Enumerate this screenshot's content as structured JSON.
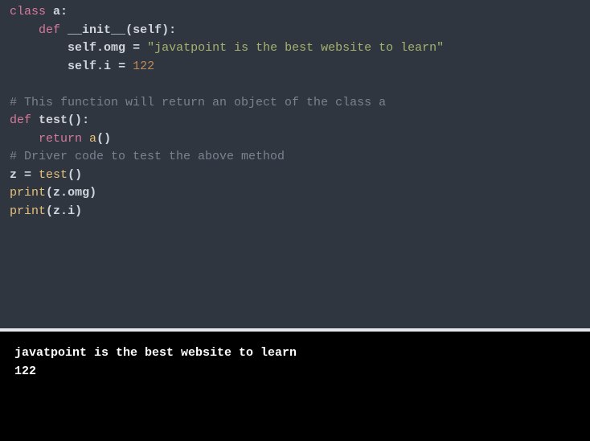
{
  "code": {
    "l1": {
      "kw": "class",
      "sp1": " ",
      "name": "a",
      "colon": ":"
    },
    "l2": {
      "indent": "    ",
      "kw": "def",
      "sp1": " ",
      "fn": "__init__",
      "paren_open": "(",
      "self": "self",
      "paren_close": ")",
      "colon": ":"
    },
    "l3": {
      "indent": "        ",
      "self": "self",
      "dot": ".",
      "attr": "omg ",
      "eq": "=",
      "sp": " ",
      "str": "\"javatpoint is the best website to learn\""
    },
    "l4": {
      "indent": "        ",
      "self": "self",
      "dot": ".",
      "attr": "i ",
      "eq": "=",
      "sp": " ",
      "num": "122"
    },
    "blank1": "  ",
    "l5": {
      "cmt": "# This function will return an object of the class a"
    },
    "l6": {
      "kw": "def",
      "sp1": " ",
      "fn": "test",
      "parens": "()",
      "colon": ":"
    },
    "l7": {
      "indent": "    ",
      "kw": "return",
      "sp1": " ",
      "call": "a",
      "parens": "()"
    },
    "l8": {
      "cmt": "# Driver code to test the above method"
    },
    "l9": {
      "lhs": "z ",
      "eq": "=",
      "sp": " ",
      "call": "test",
      "parens": "()"
    },
    "l10": {
      "call": "print",
      "po": "(",
      "obj": "z",
      "dot": ".",
      "attr": "omg",
      "pc": ")"
    },
    "l11": {
      "call": "print",
      "po": "(",
      "obj": "z",
      "dot": ".",
      "attr": "i",
      "pc": ")"
    }
  },
  "output": {
    "line1": "javatpoint is the best website to learn",
    "line2": "122"
  }
}
